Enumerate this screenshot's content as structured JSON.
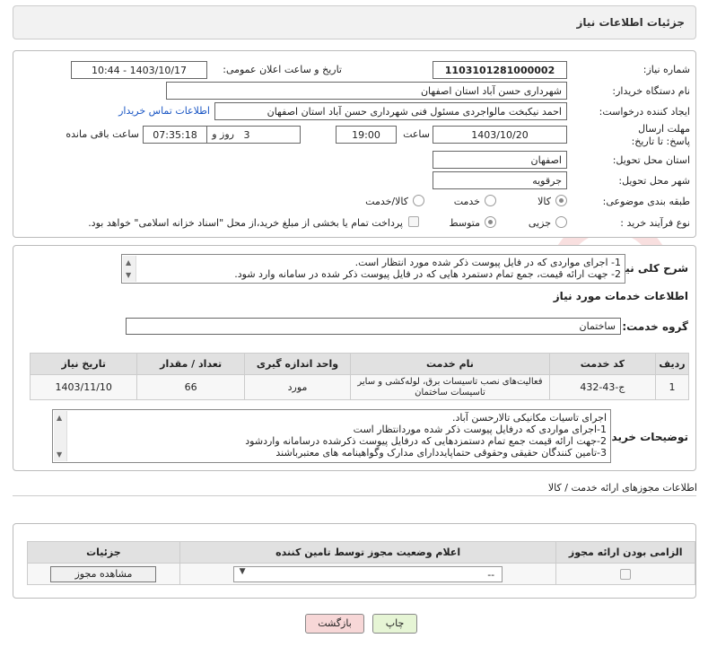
{
  "header": {
    "title": "جزئیات اطلاعات نیاز"
  },
  "fields": {
    "need_number_label": "شماره نیاز:",
    "need_number": "1103101281000002",
    "announce_label": "تاریخ و ساعت اعلان عمومی:",
    "announce_value": "1403/10/17 - 10:44",
    "buyer_org_label": "نام دستگاه خریدار:",
    "buyer_org": "شهرداری حسن آباد استان اصفهان",
    "creator_label": "ایجاد کننده درخواست:",
    "creator": "احمد نیکبخت مالواجردی مسئول فنی شهرداری حسن آباد استان اصفهان",
    "contact_link": "اطلاعات تماس خریدار",
    "deadline_label": "مهلت ارسال پاسخ: تا تاریخ:",
    "deadline_date": "1403/10/20",
    "time_label": "ساعت",
    "deadline_time": "19:00",
    "days_value": "3",
    "days_label": "روز و",
    "remaining_time": "07:35:18",
    "remaining_label": "ساعت باقی مانده",
    "province_label": "استان محل تحویل:",
    "province": "اصفهان",
    "city_label": "شهر محل تحویل:",
    "city": "جرقویه",
    "category_label": "طبقه بندی موضوعی:",
    "category_options": [
      "کالا",
      "خدمت",
      "کالا/خدمت"
    ],
    "process_label": "نوع فرآیند خرید :",
    "process_options": [
      "جزیی",
      "متوسط"
    ],
    "payment_note": "پرداخت تمام یا بخشی از مبلغ خرید،از محل \"اسناد خزانه اسلامی\" خواهد بود."
  },
  "summary": {
    "label": "شرح کلی نیاز:",
    "lines": [
      "1- اجرای مواردی که در فایل پیوست ذکر شده مورد انتظار است.",
      "2- جهت ارائه قیمت، جمع تمام دستمرد هایی که در فایل پیوست ذکر شده در سامانه وارد شود."
    ]
  },
  "services": {
    "section_title": "اطلاعات خدمات مورد نیاز",
    "group_label": "گروه خدمت:",
    "group_value": "ساختمان",
    "columns": [
      "ردیف",
      "کد خدمت",
      "نام خدمت",
      "واحد اندازه گیری",
      "تعداد / مقدار",
      "تاریخ نیاز"
    ],
    "rows": [
      {
        "row": "1",
        "code": "ج-43-432",
        "name": "فعالیت‌های نصب تاسیسات برق، لوله‌کشی و سایر تاسیسات ساختمان",
        "unit": "مورد",
        "qty": "66",
        "date": "1403/11/10"
      }
    ]
  },
  "buyer_notes": {
    "label": "توضیحات خریدار:",
    "lines": [
      "اجرای تاسیات مکانیکی تالارحسن آباد.",
      "1-اجرای مواردی که درفایل پیوست ذکر شده موردانتظار است",
      "2-جهت ارائه قیمت جمع تمام دستمزدهایی که درفایل پیوست ذکرشده درسامانه واردشود",
      "3-تامین کنندگان حقیقی وحقوقی حتماپایددارای مدارک وگواهینامه های معتبرباشند"
    ]
  },
  "permits": {
    "section_title": "اطلاعات مجوزهای ارائه خدمت / کالا",
    "columns": [
      "الزامی بودن ارائه مجوز",
      "اعلام وضعیت مجوز توسط تامین کننده",
      "جزئیات"
    ],
    "select_value": "--",
    "view_button": "مشاهده مجوز"
  },
  "buttons": {
    "print": "چاپ",
    "back": "بازگشت"
  },
  "colors": {
    "link": "#1a56c4",
    "print_bg": "#e6f5d5",
    "back_bg": "#f7d7d7"
  }
}
